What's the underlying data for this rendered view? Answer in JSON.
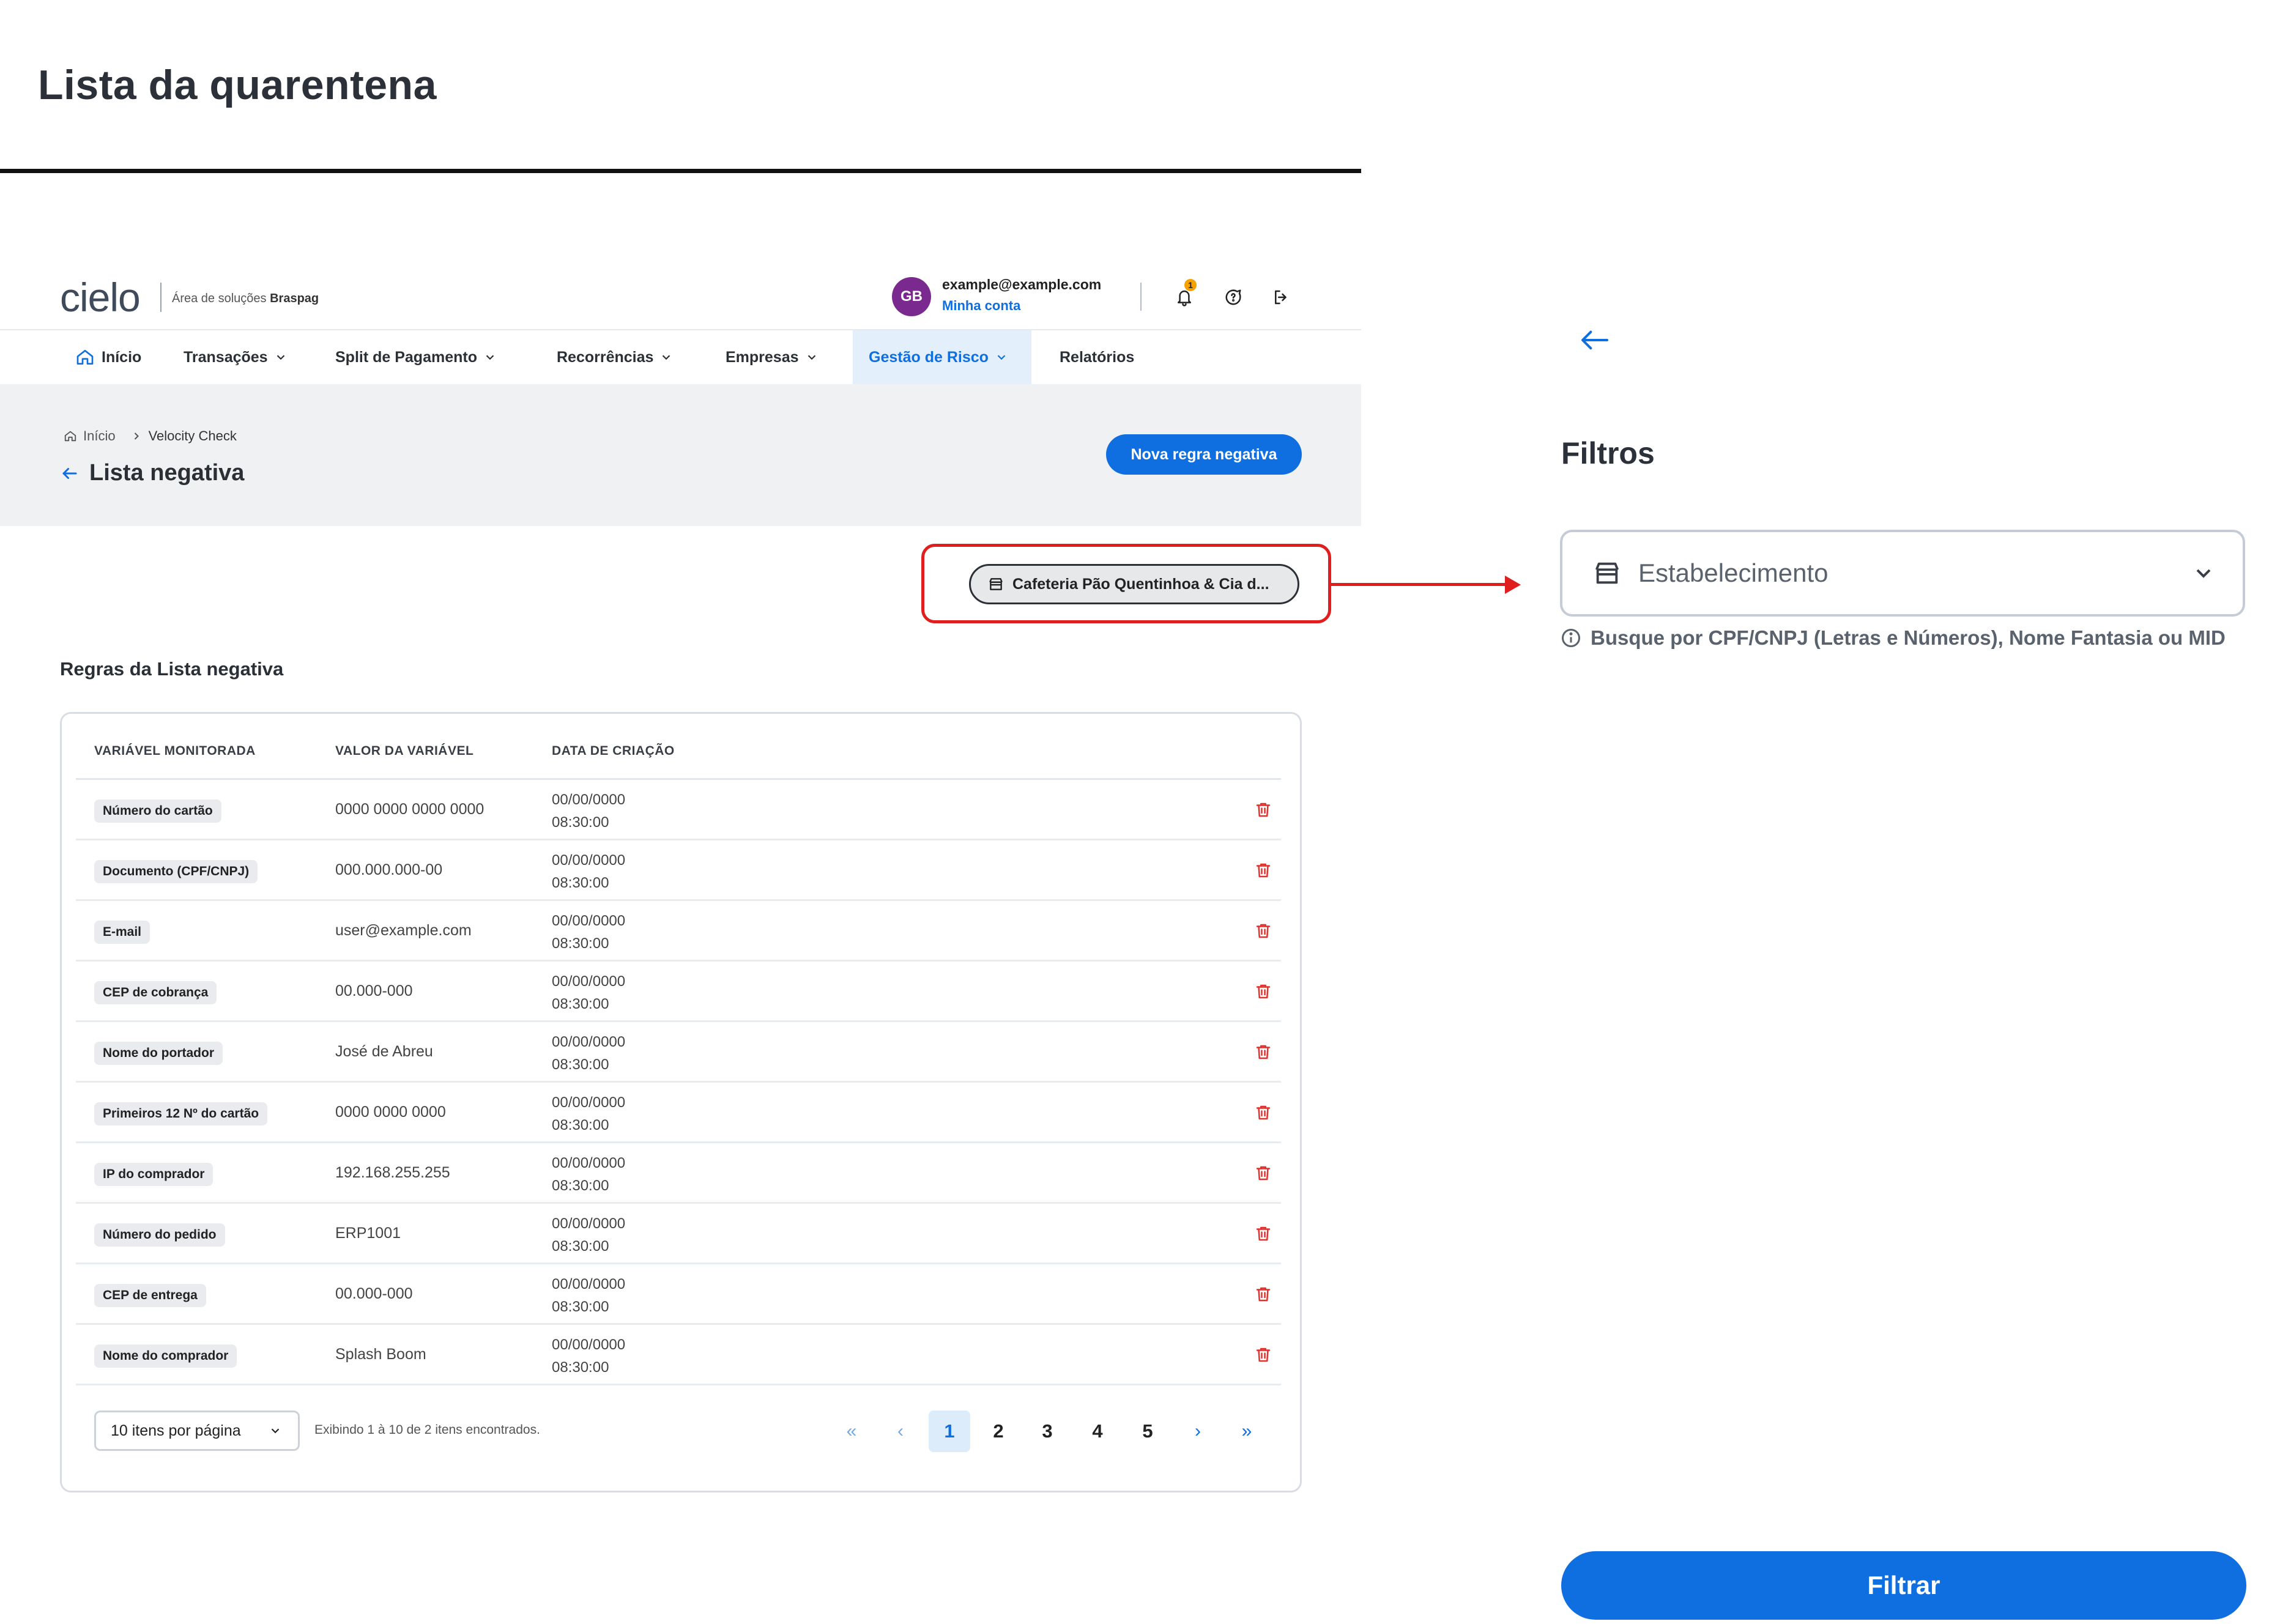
{
  "doc": {
    "title": "Lista da quarentena"
  },
  "brand": {
    "logo_text": "cielo",
    "subtitle_prefix": "Área de soluções",
    "subtitle_brand": "Braspag"
  },
  "account": {
    "initials": "GB",
    "email": "example@example.com",
    "link": "Minha conta",
    "notification_count": "1"
  },
  "nav": [
    {
      "label": "Início"
    },
    {
      "label": "Transações"
    },
    {
      "label": "Split de Pagamento"
    },
    {
      "label": "Recorrências"
    },
    {
      "label": "Empresas"
    },
    {
      "label": "Gestão de Risco"
    },
    {
      "label": "Relatórios"
    }
  ],
  "breadcrumb": {
    "home": "Início",
    "current": "Velocity Check"
  },
  "page": {
    "title": "Lista negativa",
    "new_button": "Nova regra negativa"
  },
  "merchant_chip": "Cafeteria Pão Quentinhoa & Cia d...",
  "table": {
    "section_title": "Regras da Lista negativa",
    "headers": [
      "VARIÁVEL MONITORADA",
      "VALOR DA VARIÁVEL",
      "DATA DE CRIAÇÃO"
    ],
    "rows": [
      {
        "variable": "Número do cartão",
        "value": "0000 0000 0000 0000",
        "date": "00/00/0000",
        "time": "08:30:00"
      },
      {
        "variable": "Documento (CPF/CNPJ)",
        "value": "000.000.000-00",
        "date": "00/00/0000",
        "time": "08:30:00"
      },
      {
        "variable": "E-mail",
        "value": "user@example.com",
        "date": "00/00/0000",
        "time": "08:30:00"
      },
      {
        "variable": "CEP de cobrança",
        "value": "00.000-000",
        "date": "00/00/0000",
        "time": "08:30:00"
      },
      {
        "variable": "Nome do portador",
        "value": "José de Abreu",
        "date": "00/00/0000",
        "time": "08:30:00"
      },
      {
        "variable": "Primeiros 12 Nº do cartão",
        "value": "0000 0000 0000",
        "date": "00/00/0000",
        "time": "08:30:00"
      },
      {
        "variable": "IP do comprador",
        "value": "192.168.255.255",
        "date": "00/00/0000",
        "time": "08:30:00"
      },
      {
        "variable": "Número do pedido",
        "value": "ERP1001",
        "date": "00/00/0000",
        "time": "08:30:00"
      },
      {
        "variable": "CEP de entrega",
        "value": "00.000-000",
        "date": "00/00/0000",
        "time": "08:30:00"
      },
      {
        "variable": "Nome do comprador",
        "value": "Splash Boom",
        "date": "00/00/0000",
        "time": "08:30:00"
      }
    ]
  },
  "pagination": {
    "per_page": "10 itens por página",
    "info": "Exibindo 1 à 10 de 2 itens encontrados.",
    "pages": [
      "1",
      "2",
      "3",
      "4",
      "5"
    ],
    "current": "1",
    "first": "«",
    "prev": "‹",
    "next": "›",
    "last": "»"
  },
  "filters": {
    "title": "Filtros",
    "field_label": "Estabelecimento",
    "help": "Busque por CPF/CNPJ (Letras e Números), Nome Fantasia ou MID",
    "submit": "Filtrar"
  },
  "colors": {
    "primary": "#0f6fe0",
    "highlight": "#e01e1e",
    "delete": "#e0322e",
    "avatar": "#7a2a8e",
    "badge": "#f5a200"
  }
}
